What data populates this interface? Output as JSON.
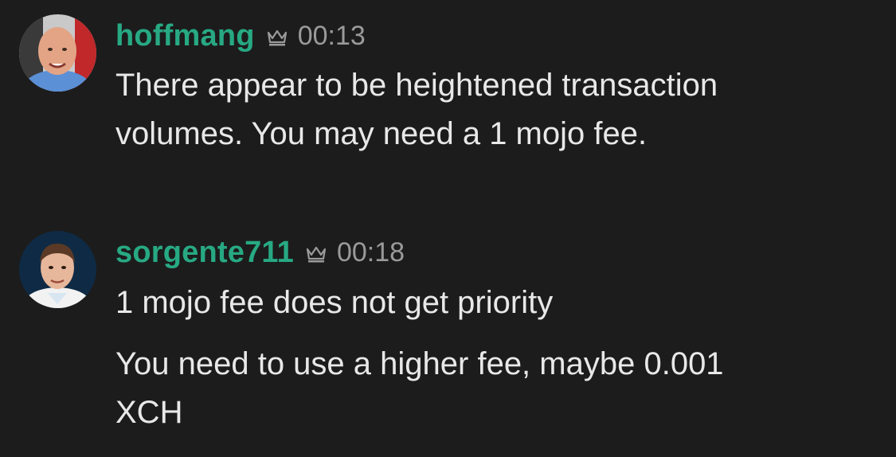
{
  "colors": {
    "background": "#1c1c1c",
    "username": "#27a983",
    "timestamp": "#9a9a9a",
    "text": "#e8e8e8"
  },
  "messages": [
    {
      "username": "hoffmang",
      "badge_icon": "crown-icon",
      "time": "00:13",
      "lines": [
        "There appear to be heightened transaction volumes. You may need a 1 mojo fee."
      ]
    },
    {
      "username": "sorgente711",
      "badge_icon": "crown-icon",
      "time": "00:18",
      "lines": [
        "1 mojo fee does not get priority",
        "You need to use a higher fee, maybe 0.001 XCH"
      ]
    }
  ]
}
